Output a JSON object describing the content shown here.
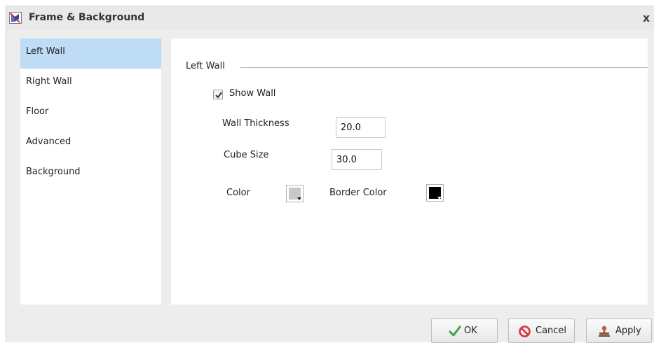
{
  "window": {
    "title": "Frame & Background",
    "title_icon": "chart-wall-icon",
    "close_glyph": "x"
  },
  "nav": {
    "items": [
      {
        "label": "Left Wall",
        "active": true
      },
      {
        "label": "Right Wall",
        "active": false
      },
      {
        "label": "Floor",
        "active": false
      },
      {
        "label": "Advanced",
        "active": false
      },
      {
        "label": "Background",
        "active": false
      }
    ]
  },
  "panel": {
    "section_title": "Left Wall",
    "show_wall": {
      "label": "Show Wall",
      "checked": true
    },
    "wall_thickness": {
      "label": "Wall Thickness",
      "value": "20.0"
    },
    "cube_size": {
      "label": "Cube Size",
      "value": "30.0"
    },
    "color": {
      "label": "Color",
      "value": "#c8c8c8"
    },
    "border_color": {
      "label": "Border Color",
      "value": "#000000"
    }
  },
  "buttons": {
    "ok": "OK",
    "cancel": "Cancel",
    "apply": "Apply"
  },
  "colors": {
    "nav_active": "#bfdcf7",
    "ok_check": "#3aa655",
    "cancel_icon": "#d9343a"
  }
}
